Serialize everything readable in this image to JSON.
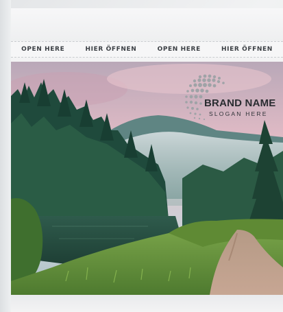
{
  "tear_strip": {
    "labels": [
      "OPEN HERE",
      "HIER ÖFFNEN",
      "OPEN HERE",
      "HIER ÖFFNEN"
    ]
  },
  "brand": {
    "name": "BRAND NAME",
    "slogan": "SLOGAN HERE",
    "logo_icon": "dotted-sphere-icon"
  },
  "photo": {
    "scene": "forest-lake-mountain-path"
  },
  "colors": {
    "sky_pink": "#e8b9c4",
    "forest_dark": "#1f4a3c",
    "grass_green": "#6e9a3c",
    "logo_gray": "#9fa3a7"
  }
}
